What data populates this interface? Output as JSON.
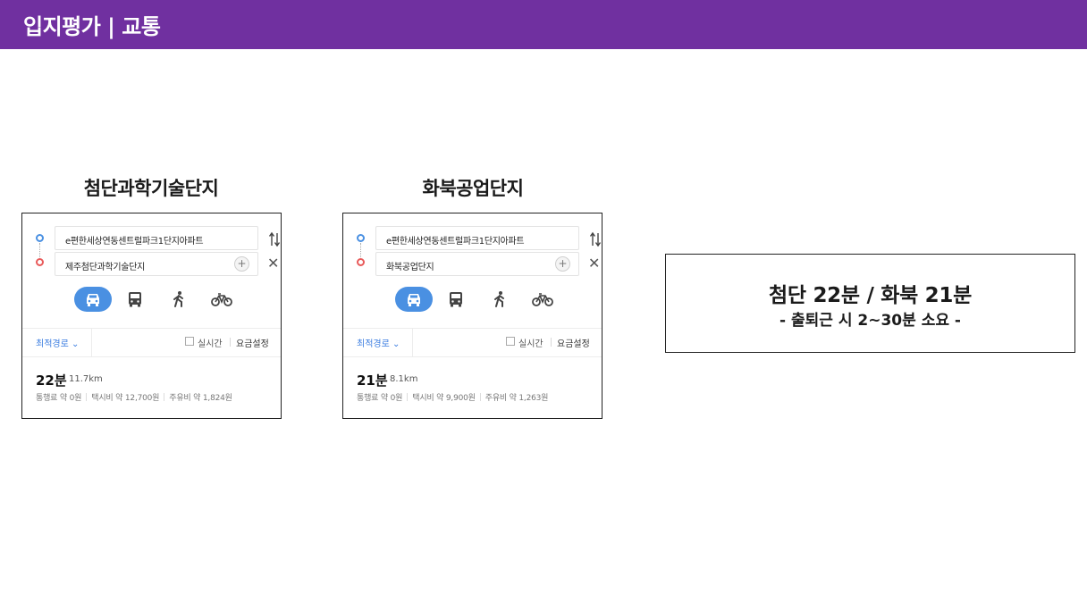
{
  "header": {
    "title": "입지평가 | 교통"
  },
  "panels": [
    {
      "heading": "첨단과학기술단지",
      "start": "e편한세상연동센트럴파크1단지아파트",
      "destination": "제주첨단과학기술단지",
      "route_option": "최적경로 ⌄",
      "realtime_label": "실시간",
      "fare_setting": "요금설정",
      "time": "22분",
      "distance": "11.7km",
      "toll": "통행료 약 0원",
      "taxi": "택시비 약 12,700원",
      "fuel": "주유비 약 1,824원"
    },
    {
      "heading": "화북공업단지",
      "start": "e편한세상연동센트럴파크1단지아파트",
      "destination": "화북공업단지",
      "route_option": "최적경로 ⌄",
      "realtime_label": "실시간",
      "fare_setting": "요금설정",
      "time": "21분",
      "distance": "8.1km",
      "toll": "통행료 약 0원",
      "taxi": "택시비 약 9,900원",
      "fuel": "주유비 약 1,263원"
    }
  ],
  "summary": {
    "main": "첨단 22분 / 화북 21분",
    "sub": "- 출퇴근 시 2~30분 소요 -"
  },
  "icons": {
    "transport_modes": [
      "car-icon",
      "bus-icon",
      "walk-icon",
      "bike-icon"
    ],
    "selected_mode": "car-icon",
    "swap": "swap-arrows-icon",
    "close": "close-icon",
    "add": "plus-icon"
  },
  "colors": {
    "header_bg": "#7030a0",
    "accent_blue": "#4a90e2",
    "start_marker": "#4a90e2",
    "end_marker": "#e85a5a"
  }
}
